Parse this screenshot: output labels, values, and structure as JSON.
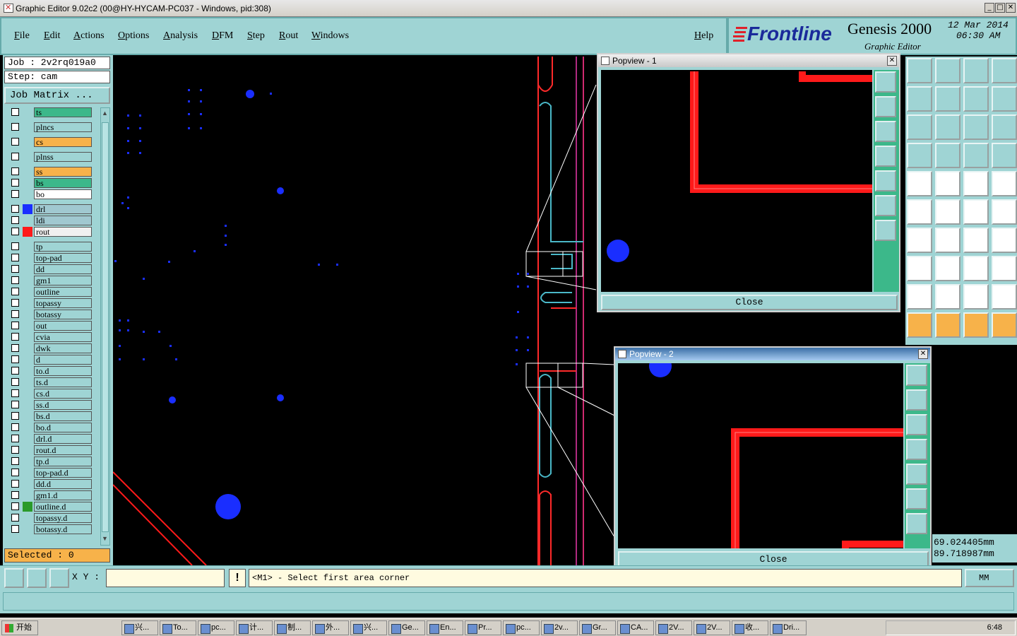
{
  "window": {
    "title": "Graphic Editor 9.02c2 (00@HY-HYCAM-PC037 - Windows, pid:308)"
  },
  "menu": [
    {
      "label": "File"
    },
    {
      "label": "Edit"
    },
    {
      "label": "Actions"
    },
    {
      "label": "Options"
    },
    {
      "label": "Analysis"
    },
    {
      "label": "DFM"
    },
    {
      "label": "Step"
    },
    {
      "label": "Rout"
    },
    {
      "label": "Windows"
    }
  ],
  "help_label": "Help",
  "brand": {
    "logo": "Frontline",
    "product": "Genesis 2000",
    "subtitle": "Graphic Editor",
    "date": "12 Mar 2014",
    "time": "06:30 AM"
  },
  "job": {
    "job": "Job : 2v2rq019a0",
    "step": "Step: cam",
    "matrix_button": "Job Matrix ..."
  },
  "layers": [
    {
      "name": "ts",
      "color": "#3cb88a",
      "swatch": ""
    },
    {
      "name": "plncs",
      "color": "#9fd4d4",
      "swatch": ""
    },
    {
      "name": "cs",
      "color": "#f7b24a",
      "swatch": ""
    },
    {
      "name": "plnss",
      "color": "#9fd4d4",
      "swatch": ""
    },
    {
      "name": "ss",
      "color": "#f7b24a",
      "swatch": ""
    },
    {
      "name": "bs",
      "color": "#3cb88a",
      "swatch": ""
    },
    {
      "name": "bo",
      "color": "#ffffff",
      "swatch": ""
    },
    {
      "name": "drl",
      "color": "#a0c8d0",
      "swatch": "#1a2eff"
    },
    {
      "name": "ldi",
      "color": "#a0c8d0",
      "swatch": ""
    },
    {
      "name": "rout",
      "color": "#f0f0f0",
      "swatch": "#ff1a1a"
    },
    {
      "name": "tp",
      "color": "#9fd4d4",
      "swatch": ""
    },
    {
      "name": "top-pad",
      "color": "#9fd4d4",
      "swatch": ""
    },
    {
      "name": "dd",
      "color": "#9fd4d4",
      "swatch": ""
    },
    {
      "name": "gm1",
      "color": "#9fd4d4",
      "swatch": ""
    },
    {
      "name": "outline",
      "color": "#9fd4d4",
      "swatch": ""
    },
    {
      "name": "topassy",
      "color": "#9fd4d4",
      "swatch": ""
    },
    {
      "name": "botassy",
      "color": "#9fd4d4",
      "swatch": ""
    },
    {
      "name": "out",
      "color": "#9fd4d4",
      "swatch": ""
    },
    {
      "name": "cvia",
      "color": "#9fd4d4",
      "swatch": ""
    },
    {
      "name": "dwk",
      "color": "#9fd4d4",
      "swatch": ""
    },
    {
      "name": "d",
      "color": "#9fd4d4",
      "swatch": ""
    },
    {
      "name": "to.d",
      "color": "#9fd4d4",
      "swatch": ""
    },
    {
      "name": "ts.d",
      "color": "#9fd4d4",
      "swatch": ""
    },
    {
      "name": "cs.d",
      "color": "#9fd4d4",
      "swatch": ""
    },
    {
      "name": "ss.d",
      "color": "#9fd4d4",
      "swatch": ""
    },
    {
      "name": "bs.d",
      "color": "#9fd4d4",
      "swatch": ""
    },
    {
      "name": "bo.d",
      "color": "#9fd4d4",
      "swatch": ""
    },
    {
      "name": "drl.d",
      "color": "#9fd4d4",
      "swatch": ""
    },
    {
      "name": "rout.d",
      "color": "#9fd4d4",
      "swatch": ""
    },
    {
      "name": "tp.d",
      "color": "#9fd4d4",
      "swatch": ""
    },
    {
      "name": "top-pad.d",
      "color": "#9fd4d4",
      "swatch": ""
    },
    {
      "name": "dd.d",
      "color": "#9fd4d4",
      "swatch": ""
    },
    {
      "name": "gm1.d",
      "color": "#9fd4d4",
      "swatch": ""
    },
    {
      "name": "outline.d",
      "color": "#9fd4d4",
      "swatch": "#2a9a2a"
    },
    {
      "name": "topassy.d",
      "color": "#9fd4d4",
      "swatch": ""
    },
    {
      "name": "botassy.d",
      "color": "#9fd4d4",
      "swatch": ""
    }
  ],
  "selected": "Selected : 0",
  "popview1": {
    "title": "Popview - 1",
    "close": "Close"
  },
  "popview2": {
    "title": "Popview - 2",
    "close": "Close"
  },
  "coords": {
    "x": "69.024405mm",
    "y": "89.718987mm"
  },
  "status": {
    "xy_label": "X Y :",
    "xy_value": "",
    "message": "<M1> - Select first area corner",
    "units": "MM"
  },
  "taskbar": {
    "start": "开始",
    "tasks": [
      "兴...",
      "To...",
      "pc...",
      "计...",
      "制...",
      "外...",
      "兴...",
      "Ge...",
      "En...",
      "Pr...",
      "pc...",
      "2v...",
      "Gr...",
      "CA...",
      "2V...",
      "2V...",
      "收...",
      "Dri..."
    ],
    "clock": "6:48"
  }
}
